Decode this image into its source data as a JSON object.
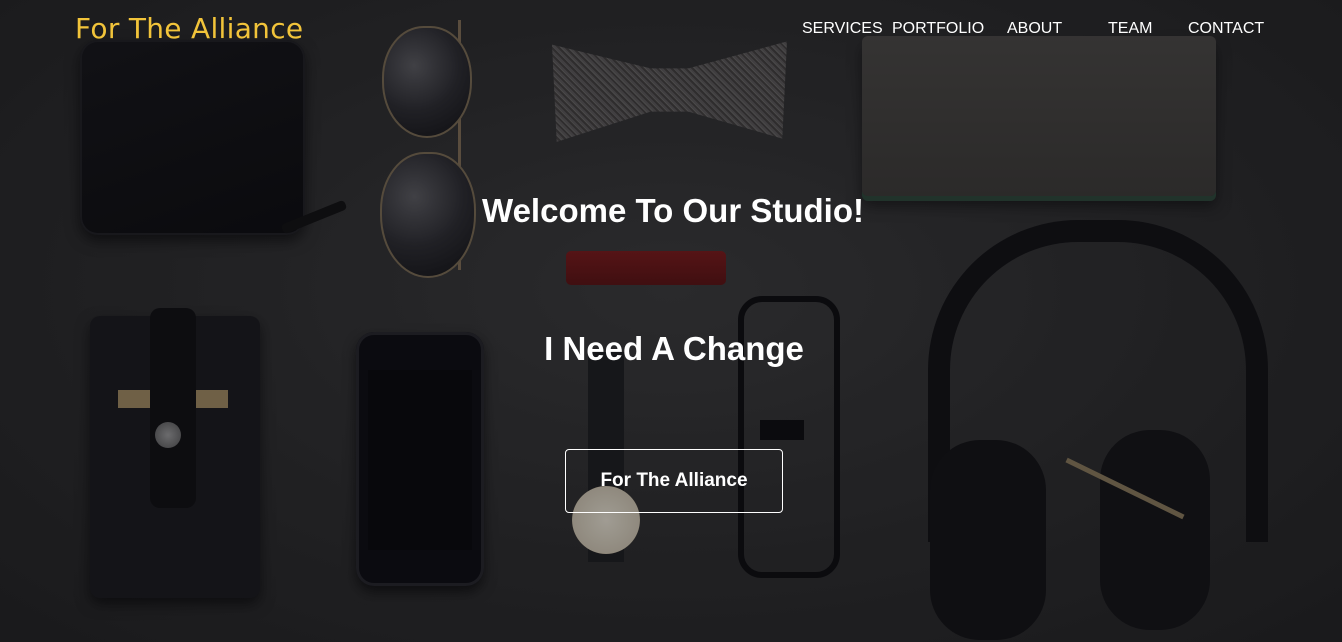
{
  "brand": {
    "name": "For The Alliance",
    "color": "#f2c43a"
  },
  "nav": {
    "items": [
      {
        "label": "SERVICES"
      },
      {
        "label": "PORTFOLIO"
      },
      {
        "label": "ABOUT"
      },
      {
        "label": "TEAM"
      },
      {
        "label": "CONTACT"
      }
    ]
  },
  "hero": {
    "title": "Welcome To Our Studio!",
    "subtitle": "I Need A Change",
    "cta_label": "For The Alliance"
  }
}
